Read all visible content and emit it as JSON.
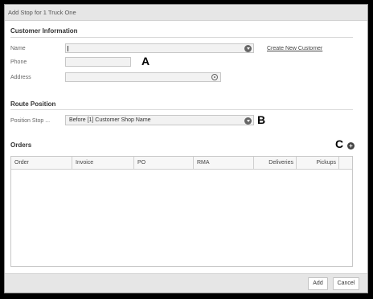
{
  "dialog": {
    "title": "Add Stop for 1 Truck One"
  },
  "customer": {
    "section_title": "Customer Information",
    "name_label": "Name",
    "name_value": "",
    "phone_label": "Phone",
    "phone_value": "",
    "address_label": "Address",
    "address_value": "",
    "create_link": "Create New Customer"
  },
  "route": {
    "section_title": "Route Position",
    "position_label": "Position Stop ...",
    "position_value": "Before [1] Customer Shop Name"
  },
  "orders": {
    "section_title": "Orders",
    "columns": [
      "Order",
      "Invoice",
      "PO",
      "RMA",
      "Deliveries",
      "Pickups"
    ]
  },
  "annotations": {
    "a": "A",
    "b": "B",
    "c": "C"
  },
  "icons": {
    "name_dropdown": "chevron-down-icon",
    "address_locate": "target-icon",
    "position_dropdown": "chevron-down-icon",
    "add_order": "plus-circle-icon"
  },
  "footer": {
    "add_label": "Add",
    "cancel_label": "Cancel"
  }
}
